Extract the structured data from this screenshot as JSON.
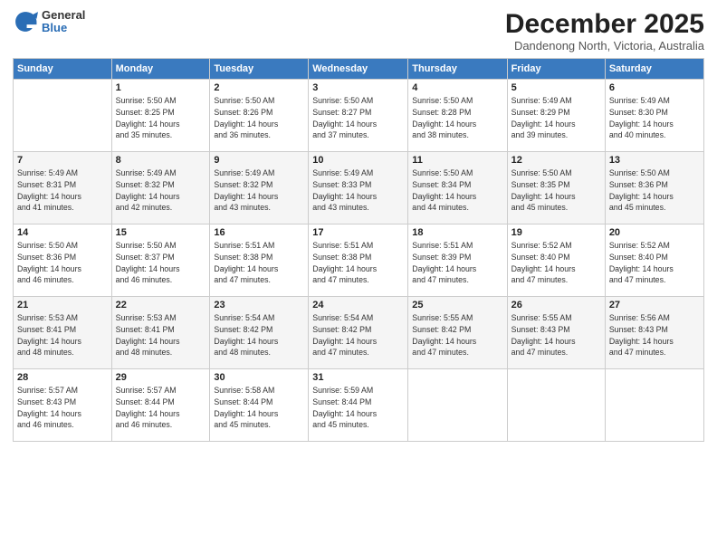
{
  "logo": {
    "general": "General",
    "blue": "Blue"
  },
  "header": {
    "month": "December 2025",
    "location": "Dandenong North, Victoria, Australia"
  },
  "weekdays": [
    "Sunday",
    "Monday",
    "Tuesday",
    "Wednesday",
    "Thursday",
    "Friday",
    "Saturday"
  ],
  "weeks": [
    [
      {
        "day": "",
        "info": ""
      },
      {
        "day": "1",
        "info": "Sunrise: 5:50 AM\nSunset: 8:25 PM\nDaylight: 14 hours\nand 35 minutes."
      },
      {
        "day": "2",
        "info": "Sunrise: 5:50 AM\nSunset: 8:26 PM\nDaylight: 14 hours\nand 36 minutes."
      },
      {
        "day": "3",
        "info": "Sunrise: 5:50 AM\nSunset: 8:27 PM\nDaylight: 14 hours\nand 37 minutes."
      },
      {
        "day": "4",
        "info": "Sunrise: 5:50 AM\nSunset: 8:28 PM\nDaylight: 14 hours\nand 38 minutes."
      },
      {
        "day": "5",
        "info": "Sunrise: 5:49 AM\nSunset: 8:29 PM\nDaylight: 14 hours\nand 39 minutes."
      },
      {
        "day": "6",
        "info": "Sunrise: 5:49 AM\nSunset: 8:30 PM\nDaylight: 14 hours\nand 40 minutes."
      }
    ],
    [
      {
        "day": "7",
        "info": "Sunrise: 5:49 AM\nSunset: 8:31 PM\nDaylight: 14 hours\nand 41 minutes."
      },
      {
        "day": "8",
        "info": "Sunrise: 5:49 AM\nSunset: 8:32 PM\nDaylight: 14 hours\nand 42 minutes."
      },
      {
        "day": "9",
        "info": "Sunrise: 5:49 AM\nSunset: 8:32 PM\nDaylight: 14 hours\nand 43 minutes."
      },
      {
        "day": "10",
        "info": "Sunrise: 5:49 AM\nSunset: 8:33 PM\nDaylight: 14 hours\nand 43 minutes."
      },
      {
        "day": "11",
        "info": "Sunrise: 5:50 AM\nSunset: 8:34 PM\nDaylight: 14 hours\nand 44 minutes."
      },
      {
        "day": "12",
        "info": "Sunrise: 5:50 AM\nSunset: 8:35 PM\nDaylight: 14 hours\nand 45 minutes."
      },
      {
        "day": "13",
        "info": "Sunrise: 5:50 AM\nSunset: 8:36 PM\nDaylight: 14 hours\nand 45 minutes."
      }
    ],
    [
      {
        "day": "14",
        "info": "Sunrise: 5:50 AM\nSunset: 8:36 PM\nDaylight: 14 hours\nand 46 minutes."
      },
      {
        "day": "15",
        "info": "Sunrise: 5:50 AM\nSunset: 8:37 PM\nDaylight: 14 hours\nand 46 minutes."
      },
      {
        "day": "16",
        "info": "Sunrise: 5:51 AM\nSunset: 8:38 PM\nDaylight: 14 hours\nand 47 minutes."
      },
      {
        "day": "17",
        "info": "Sunrise: 5:51 AM\nSunset: 8:38 PM\nDaylight: 14 hours\nand 47 minutes."
      },
      {
        "day": "18",
        "info": "Sunrise: 5:51 AM\nSunset: 8:39 PM\nDaylight: 14 hours\nand 47 minutes."
      },
      {
        "day": "19",
        "info": "Sunrise: 5:52 AM\nSunset: 8:40 PM\nDaylight: 14 hours\nand 47 minutes."
      },
      {
        "day": "20",
        "info": "Sunrise: 5:52 AM\nSunset: 8:40 PM\nDaylight: 14 hours\nand 47 minutes."
      }
    ],
    [
      {
        "day": "21",
        "info": "Sunrise: 5:53 AM\nSunset: 8:41 PM\nDaylight: 14 hours\nand 48 minutes."
      },
      {
        "day": "22",
        "info": "Sunrise: 5:53 AM\nSunset: 8:41 PM\nDaylight: 14 hours\nand 48 minutes."
      },
      {
        "day": "23",
        "info": "Sunrise: 5:54 AM\nSunset: 8:42 PM\nDaylight: 14 hours\nand 48 minutes."
      },
      {
        "day": "24",
        "info": "Sunrise: 5:54 AM\nSunset: 8:42 PM\nDaylight: 14 hours\nand 47 minutes."
      },
      {
        "day": "25",
        "info": "Sunrise: 5:55 AM\nSunset: 8:42 PM\nDaylight: 14 hours\nand 47 minutes."
      },
      {
        "day": "26",
        "info": "Sunrise: 5:55 AM\nSunset: 8:43 PM\nDaylight: 14 hours\nand 47 minutes."
      },
      {
        "day": "27",
        "info": "Sunrise: 5:56 AM\nSunset: 8:43 PM\nDaylight: 14 hours\nand 47 minutes."
      }
    ],
    [
      {
        "day": "28",
        "info": "Sunrise: 5:57 AM\nSunset: 8:43 PM\nDaylight: 14 hours\nand 46 minutes."
      },
      {
        "day": "29",
        "info": "Sunrise: 5:57 AM\nSunset: 8:44 PM\nDaylight: 14 hours\nand 46 minutes."
      },
      {
        "day": "30",
        "info": "Sunrise: 5:58 AM\nSunset: 8:44 PM\nDaylight: 14 hours\nand 45 minutes."
      },
      {
        "day": "31",
        "info": "Sunrise: 5:59 AM\nSunset: 8:44 PM\nDaylight: 14 hours\nand 45 minutes."
      },
      {
        "day": "",
        "info": ""
      },
      {
        "day": "",
        "info": ""
      },
      {
        "day": "",
        "info": ""
      }
    ]
  ]
}
